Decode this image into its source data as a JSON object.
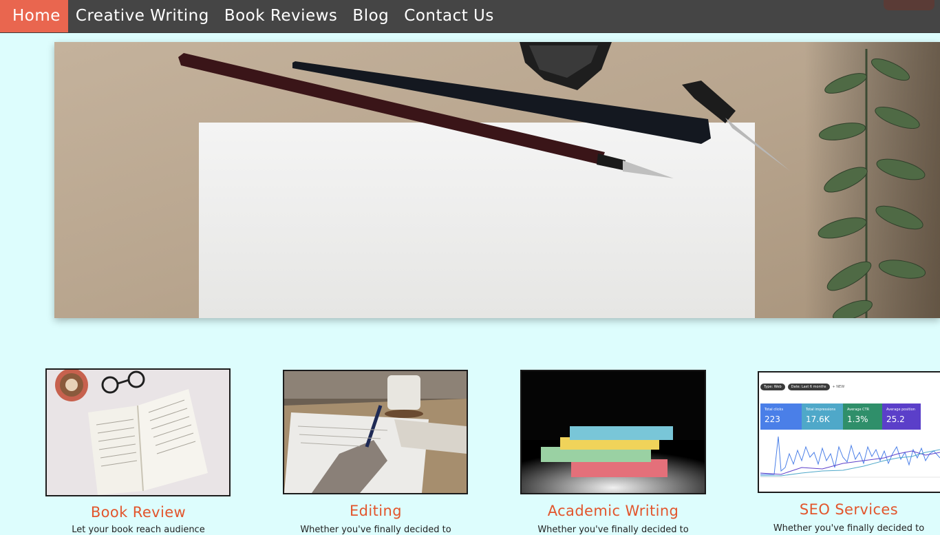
{
  "nav": {
    "items": [
      {
        "label": "Home",
        "active": true
      },
      {
        "label": "Creative Writing",
        "active": false
      },
      {
        "label": "Book Reviews",
        "active": false
      },
      {
        "label": "Blog",
        "active": false
      },
      {
        "label": "Contact Us",
        "active": false
      }
    ]
  },
  "hero": {
    "image": "desk-with-pens-and-paper"
  },
  "cards": [
    {
      "title": "Book Review",
      "image": "open-book-coffee-glasses",
      "text": "Let your book reach audience"
    },
    {
      "title": "Editing",
      "image": "hand-writing-on-paper",
      "text": "Whether you've finally decided to"
    },
    {
      "title": "Academic Writing",
      "image": "stack-of-colored-notepads",
      "text": "Whether you've finally decided to"
    },
    {
      "title": "SEO Services",
      "image": "search-console-dashboard",
      "text": "Whether you've finally decided to",
      "dashboard": {
        "filter1": "Type: Web",
        "filter2": "Date: Last 6 months",
        "new_label": "+ NEW",
        "metrics": [
          {
            "label": "Total clicks",
            "value": "223",
            "color": "#4a7fe8"
          },
          {
            "label": "Total impressions",
            "value": "17.6K",
            "color": "#4fa8c9"
          },
          {
            "label": "Average CTR",
            "value": "1.3%",
            "color": "#2f8f6a"
          },
          {
            "label": "Average position",
            "value": "25.2",
            "color": "#5b3fc9"
          }
        ]
      }
    }
  ],
  "colors": {
    "accent": "#e9664f",
    "nav_bg": "#454545",
    "page_bg": "#ddfdfd",
    "title": "#e2552c"
  }
}
